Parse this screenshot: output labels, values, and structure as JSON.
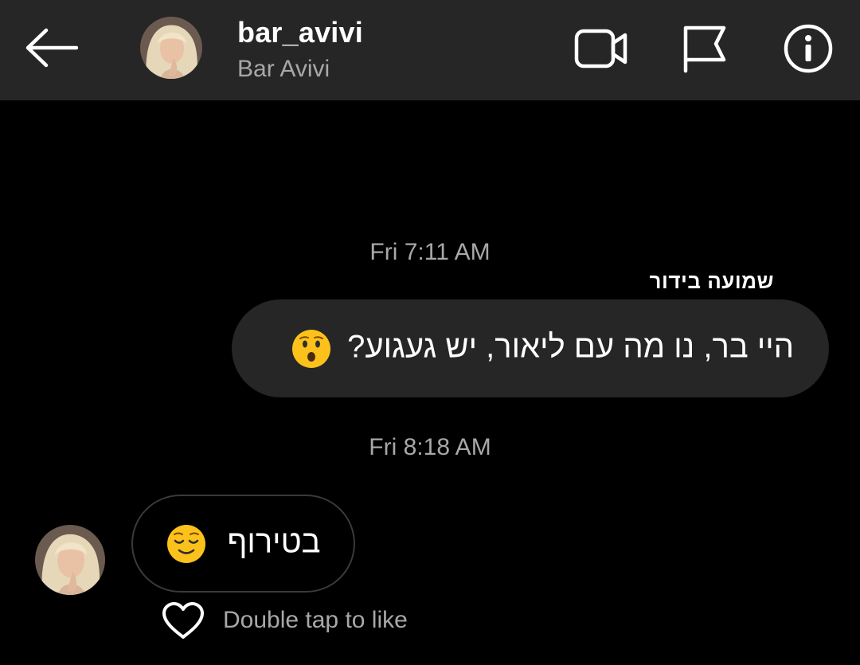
{
  "header": {
    "username": "bar_avivi",
    "full_name": "Bar Avivi",
    "icons": {
      "back": "arrow-left-icon",
      "video_call": "video-camera-icon",
      "report": "flag-icon",
      "info": "info-icon"
    }
  },
  "messages": [
    {
      "timestamp": "Fri 7:11 AM",
      "sender_label": "שמועה בידור",
      "direction": "outgoing",
      "text": "היי בר, נו מה עם ליאור, יש געגוע?",
      "emoji": "hushed-face-emoji"
    },
    {
      "timestamp": "Fri 8:18 AM",
      "direction": "incoming",
      "text": "בטירוף",
      "emoji": "relieved-face-emoji",
      "like_hint": "Double tap to like"
    }
  ],
  "colors": {
    "background": "#000000",
    "header_bg": "#262626",
    "bubble_outgoing": "#262626",
    "bubble_incoming_border": "#3a3a3a",
    "muted_text": "#a8a8a8"
  }
}
